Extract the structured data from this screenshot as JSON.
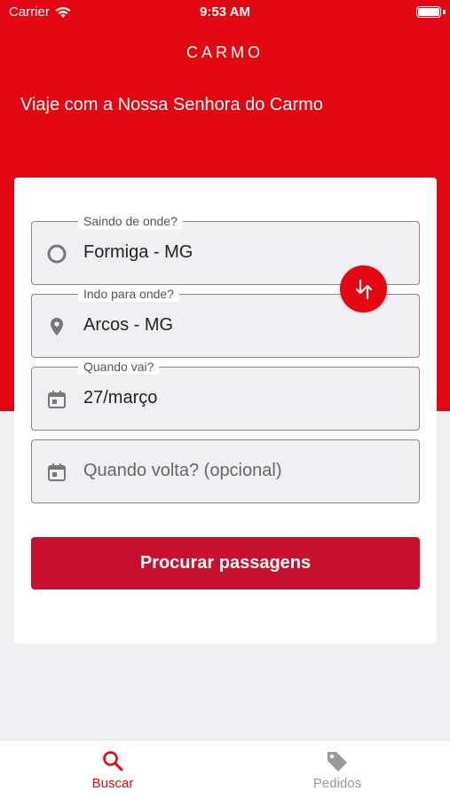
{
  "status_bar": {
    "carrier": "Carrier",
    "time": "9:53 AM"
  },
  "header": {
    "logo": "CARMO",
    "tagline": "Viaje com a Nossa Senhora do Carmo"
  },
  "form": {
    "origin": {
      "label": "Saindo de onde?",
      "value": "Formiga - MG",
      "icon": "circle-icon"
    },
    "destination": {
      "label": "Indo para onde?",
      "value": "Arcos - MG",
      "icon": "location-pin-icon"
    },
    "departure": {
      "label": "Quando vai?",
      "value": "27/março",
      "icon": "calendar-icon"
    },
    "return": {
      "placeholder": "Quando volta? (opcional)",
      "icon": "calendar-icon"
    },
    "swap_icon": "swap-arrows-icon",
    "search_label": "Procurar passagens"
  },
  "tabs": [
    {
      "label": "Buscar",
      "icon": "search-icon",
      "active": true
    },
    {
      "label": "Pedidos",
      "icon": "tag-icon",
      "active": false
    }
  ],
  "colors": {
    "brand_red": "#e30613",
    "button_red": "#c8102e",
    "inactive_tab": "#999999"
  }
}
